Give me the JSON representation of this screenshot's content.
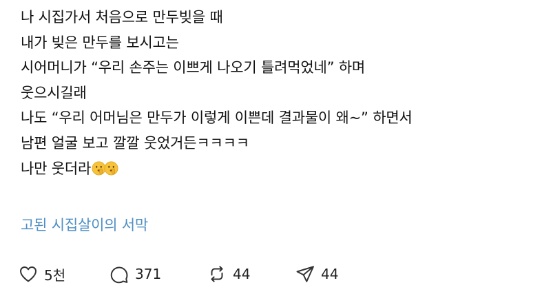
{
  "post": {
    "lines": [
      "나 시집가서 처음으로 만두빚을 때",
      "내가 빚은 만두를 보시고는",
      "시어머니가 “우리 손주는 이쁘게 나오기 틀려먹었네” 하며",
      "웃으시길래",
      "나도 “우리 어머님은 만두가 이렇게 이쁜데 결과물이 왜~” 하면서",
      "남편 얼굴 보고 깔깔 웃었거든ㅋㅋㅋㅋ",
      "나만 웃더라"
    ],
    "emojis": [
      "shushing-face-emoji",
      "shushing-face-emoji"
    ],
    "thread_link": "고된 시집살이의 서막"
  },
  "actions": {
    "like_count": "5천",
    "reply_count": "371",
    "repost_count": "44",
    "share_count": "44"
  },
  "colors": {
    "text": "#111111",
    "link": "#4f8fc4",
    "emoji": "#f6c33a"
  }
}
